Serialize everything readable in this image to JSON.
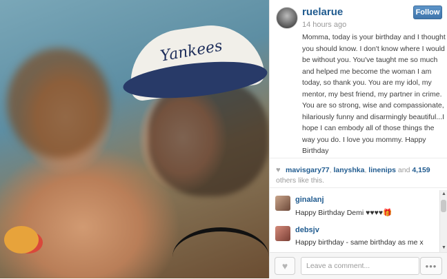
{
  "post": {
    "username": "ruelarue",
    "timestamp": "14 hours ago",
    "follow_label": "Follow",
    "caption": "Momma, today is your birthday and I thought you should know. I don't know where I would be without you. You've taught me so much and helped me become the woman I am today, so thank you. You are my idol, my mentor, my best friend, my partner in crime. You are so strong, wise and compassionate, hilariously funny and disarmingly beautiful...I hope I can embody all of those things the way you do. I love you mommy. Happy Birthday",
    "photo_cap_text": "Yankees"
  },
  "likes": {
    "users": [
      "mavisgary77",
      "lanyshka",
      "linenips"
    ],
    "and_text": "and",
    "count": "4,159",
    "suffix": "others like this."
  },
  "comments": [
    {
      "user": "ginalanj",
      "text": "Happy Birthday Demi ♥♥♥♥🎁"
    },
    {
      "user": "debsjv",
      "text": "Happy birthday - same birthday as me x"
    }
  ],
  "footer": {
    "comment_placeholder": "Leave a comment...",
    "more_label": "•••"
  },
  "icons": {
    "like": "heart-icon",
    "more": "ellipsis-icon",
    "scroll_up": "chevron-up-icon",
    "scroll_down": "chevron-down-icon"
  },
  "colors": {
    "username": "#205b8f",
    "follow_button": "#3f75ac"
  }
}
